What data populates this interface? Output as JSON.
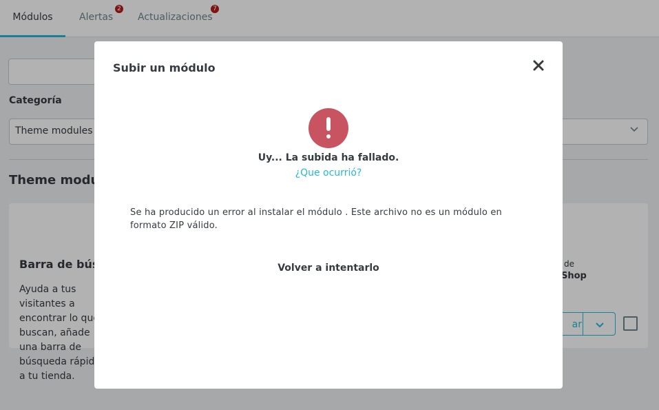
{
  "tabs": [
    {
      "label": "Módulos",
      "active": true
    },
    {
      "label": "Alertas",
      "badge": "2"
    },
    {
      "label": "Actualizaciones",
      "badge": "7"
    }
  ],
  "filters": {
    "category_label": "Categoría",
    "category_value": "Theme modules"
  },
  "section": {
    "title": "Theme modules"
  },
  "card": {
    "title": "Barra de búsqueda",
    "description": "Ayuda a tus visitantes a encontrar lo que buscan, añade una barra de búsqueda rápida a tu tienda.",
    "right_small": "de",
    "right_brand": "Shop",
    "install_label": "ar"
  },
  "modal": {
    "title": "Subir un módulo",
    "fail_message": "Uy... La subida ha fallado.",
    "what_happened_link": "¿Que ocurrió?",
    "error_text": "Se ha producido un error al instalar el módulo . Este archivo no es un módulo en formato ZIP válido.",
    "retry_label": "Volver a intentarlo"
  },
  "colors": {
    "accent": "#25b9d7",
    "error": "#c95461",
    "badge": "#b71c1c"
  }
}
